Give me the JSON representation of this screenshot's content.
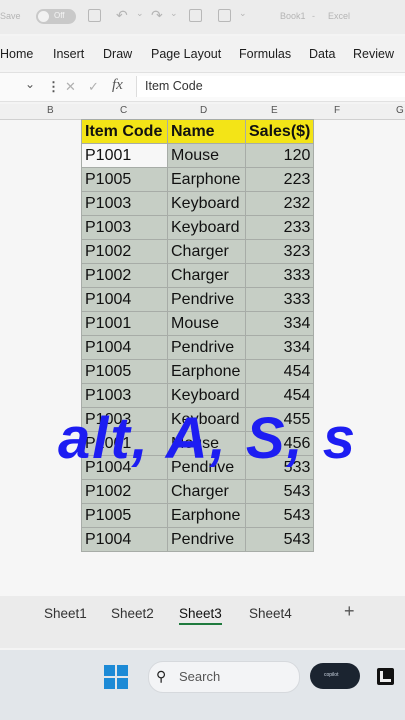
{
  "titlebar": {
    "autosave_label": "Save",
    "toggle_state": "Off",
    "doc_name": "Book1",
    "app_name": "Excel"
  },
  "ribbon": {
    "tabs": [
      "Home",
      "Insert",
      "Draw",
      "Page Layout",
      "Formulas",
      "Data",
      "Review"
    ]
  },
  "formula_bar": {
    "x_symbol": "✕",
    "check_symbol": "✓",
    "fx_symbol": "fx",
    "value": "Item Code"
  },
  "columns": [
    "B",
    "C",
    "D",
    "E",
    "F",
    "G"
  ],
  "table": {
    "headers": [
      "Item Code",
      "Name",
      "Sales($)"
    ],
    "rows": [
      [
        "P1001",
        "Mouse",
        "120"
      ],
      [
        "P1005",
        "Earphone",
        "223"
      ],
      [
        "P1003",
        "Keyboard",
        "232"
      ],
      [
        "P1003",
        "Keyboard",
        "233"
      ],
      [
        "P1002",
        "Charger",
        "323"
      ],
      [
        "P1002",
        "Charger",
        "333"
      ],
      [
        "P1004",
        "Pendrive",
        "333"
      ],
      [
        "P1001",
        "Mouse",
        "334"
      ],
      [
        "P1004",
        "Pendrive",
        "334"
      ],
      [
        "P1005",
        "Earphone",
        "454"
      ],
      [
        "P1003",
        "Keyboard",
        "454"
      ],
      [
        "P1003",
        "Keyboard",
        "455"
      ],
      [
        "P1001",
        "Mouse",
        "456"
      ],
      [
        "P1004",
        "Pendrive",
        "533"
      ],
      [
        "P1002",
        "Charger",
        "543"
      ],
      [
        "P1005",
        "Earphone",
        "543"
      ],
      [
        "P1004",
        "Pendrive",
        "543"
      ]
    ]
  },
  "overlay_text": "alt, A, S, s",
  "sheet_tabs": {
    "tabs": [
      "Sheet1",
      "Sheet2",
      "Sheet3",
      "Sheet4"
    ],
    "active": "Sheet3",
    "add_symbol": "+"
  },
  "taskbar": {
    "search_label": "Search",
    "search_icon": "search-icon",
    "pill_text": "copilot"
  },
  "colors": {
    "header_yellow": "#f3e417",
    "cell_fill": "#c6cec5",
    "overlay_blue": "#1d1df2",
    "accent_green": "#1f7a3e"
  }
}
